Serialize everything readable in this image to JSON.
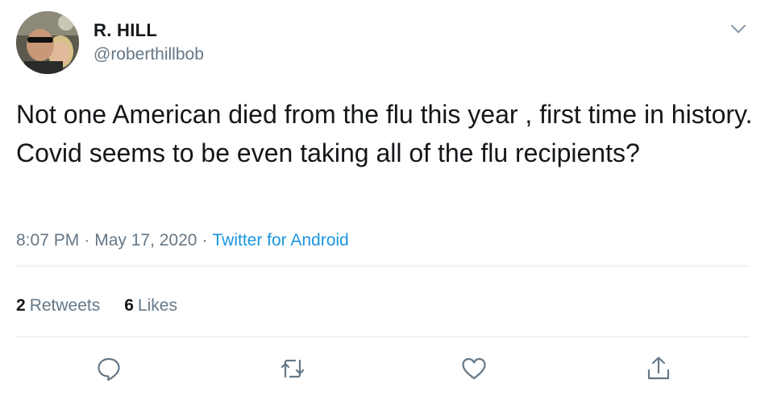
{
  "tweet": {
    "display_name": "R. HILL",
    "handle": "@roberthillbob",
    "text": "Not one American died from the flu this year , first time in history.  Covid seems to be even taking all of the flu recipients?",
    "time": "8:07 PM",
    "date": "May 17, 2020",
    "separator": "·",
    "source": "Twitter for Android"
  },
  "stats": {
    "retweets_count": "2",
    "retweets_label": "Retweets",
    "likes_count": "6",
    "likes_label": "Likes"
  },
  "icons": {
    "more": "chevron-down-icon",
    "reply": "speech-bubble-icon",
    "retweet": "retweet-icon",
    "like": "heart-icon",
    "share": "share-icon"
  },
  "colors": {
    "text": "#14171a",
    "secondary": "#657786",
    "link": "#1b95e0",
    "divider": "#e1e8ed"
  }
}
